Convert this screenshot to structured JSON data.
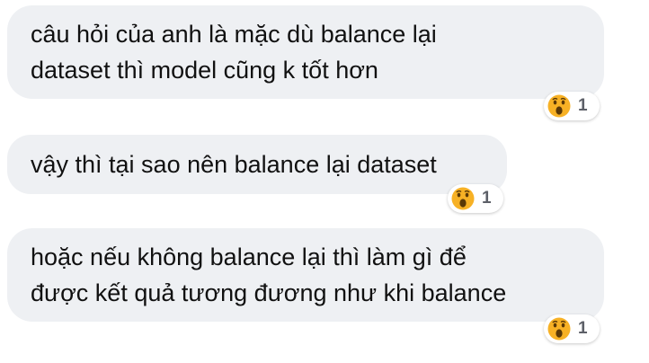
{
  "messages": [
    {
      "lines": [
        "câu hỏi của anh là mặc dù balance lại",
        "dataset thì model cũng k tốt hơn"
      ],
      "reaction": {
        "icon": "wow-face-icon",
        "count": "1"
      }
    },
    {
      "lines": [
        "vậy thì tại sao nên balance lại dataset"
      ],
      "reaction": {
        "icon": "wow-face-icon",
        "count": "1"
      }
    },
    {
      "lines": [
        "hoặc nếu không balance lại thì làm gì để",
        "được kết quả tương đương như khi balance"
      ],
      "reaction": {
        "icon": "wow-face-icon",
        "count": "1"
      }
    }
  ],
  "colors": {
    "bubble": "#eef0f3",
    "text": "#111111",
    "emoji_face": "#f7b125",
    "count_text": "#5d6068"
  }
}
